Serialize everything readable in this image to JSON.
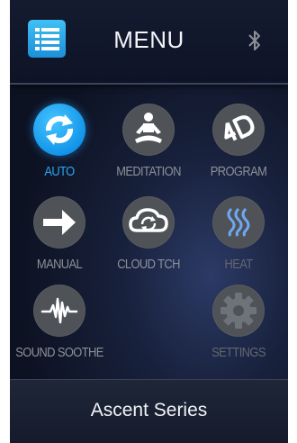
{
  "header": {
    "title": "MENU",
    "menu_icon": "list-menu-icon",
    "bluetooth_icon": "bluetooth-icon"
  },
  "tiles": [
    {
      "label": "AUTO",
      "icon": "sync-arrows-icon",
      "active": true
    },
    {
      "label": "MEDITATION",
      "icon": "meditation-icon",
      "active": false
    },
    {
      "label": "PROGRAM",
      "icon": "4d-icon",
      "active": false
    },
    {
      "label": "MANUAL",
      "icon": "arrow-right-icon",
      "active": false
    },
    {
      "label": "CLOUD TCH",
      "icon": "cloud-sync-icon",
      "active": false
    },
    {
      "label": "HEAT",
      "icon": "heat-waves-icon",
      "active": false
    },
    {
      "label": "SOUND SOOTHE",
      "icon": "sound-wave-icon",
      "active": false
    },
    {
      "label": "SETTINGS",
      "icon": "gear-icon",
      "active": false
    }
  ],
  "footer": {
    "text": "Ascent Series"
  },
  "colors": {
    "accent": "#1a9cf0",
    "background": "#121a30",
    "icon_circle": "#4f5358"
  }
}
